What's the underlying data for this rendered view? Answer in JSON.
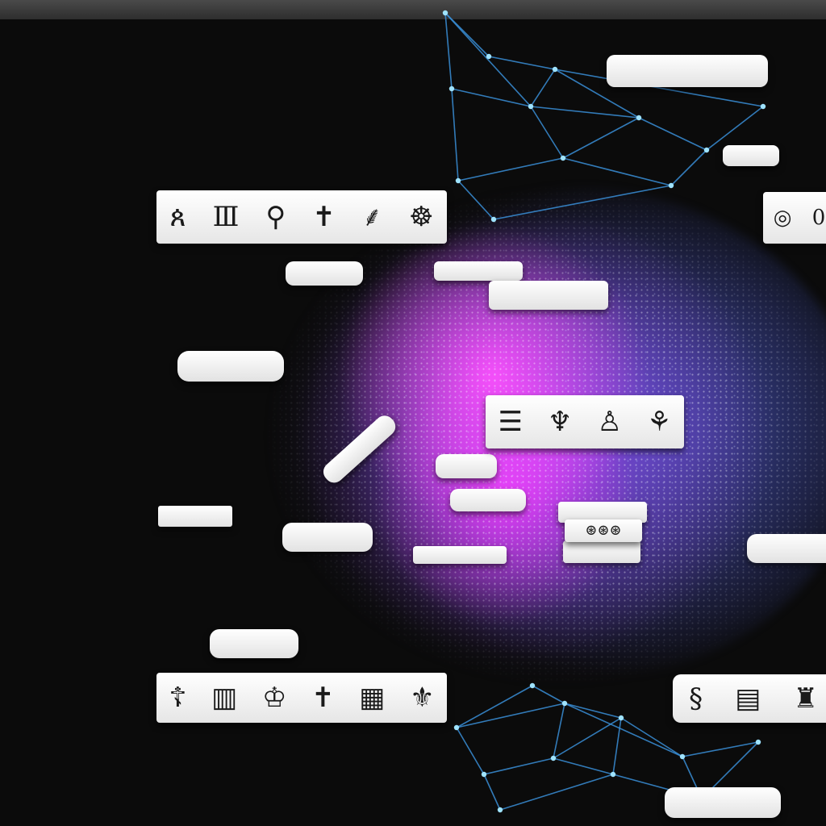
{
  "colors": {
    "background": "#0b0b0b",
    "network_line": "#3a8fd8",
    "network_node": "#9fe3ff",
    "nebula_pink": "#ff50ff",
    "nebula_violet": "#9646f0",
    "nebula_blue": "#465ac8",
    "card": "#ffffff"
  },
  "glyph_cards": [
    {
      "glyphs": [
        "glyph-a-icon",
        "glyph-b-icon",
        "glyph-c-icon",
        "glyph-d-icon",
        "glyph-e-icon",
        "glyph-f-icon"
      ]
    },
    {
      "glyphs": [
        "glyph-g-icon",
        "glyph-h-icon"
      ]
    },
    {
      "glyphs": [
        "glyph-i-icon",
        "glyph-j-icon",
        "glyph-k-icon",
        "glyph-l-icon"
      ]
    },
    {
      "glyphs": [
        "glyph-m-icon"
      ]
    },
    {
      "glyphs": [
        "glyph-n-icon",
        "glyph-o-icon",
        "glyph-p-icon",
        "glyph-q-icon",
        "glyph-r-icon",
        "glyph-s-icon"
      ]
    },
    {
      "glyphs": [
        "glyph-t-icon",
        "glyph-u-icon",
        "glyph-v-icon"
      ]
    }
  ]
}
